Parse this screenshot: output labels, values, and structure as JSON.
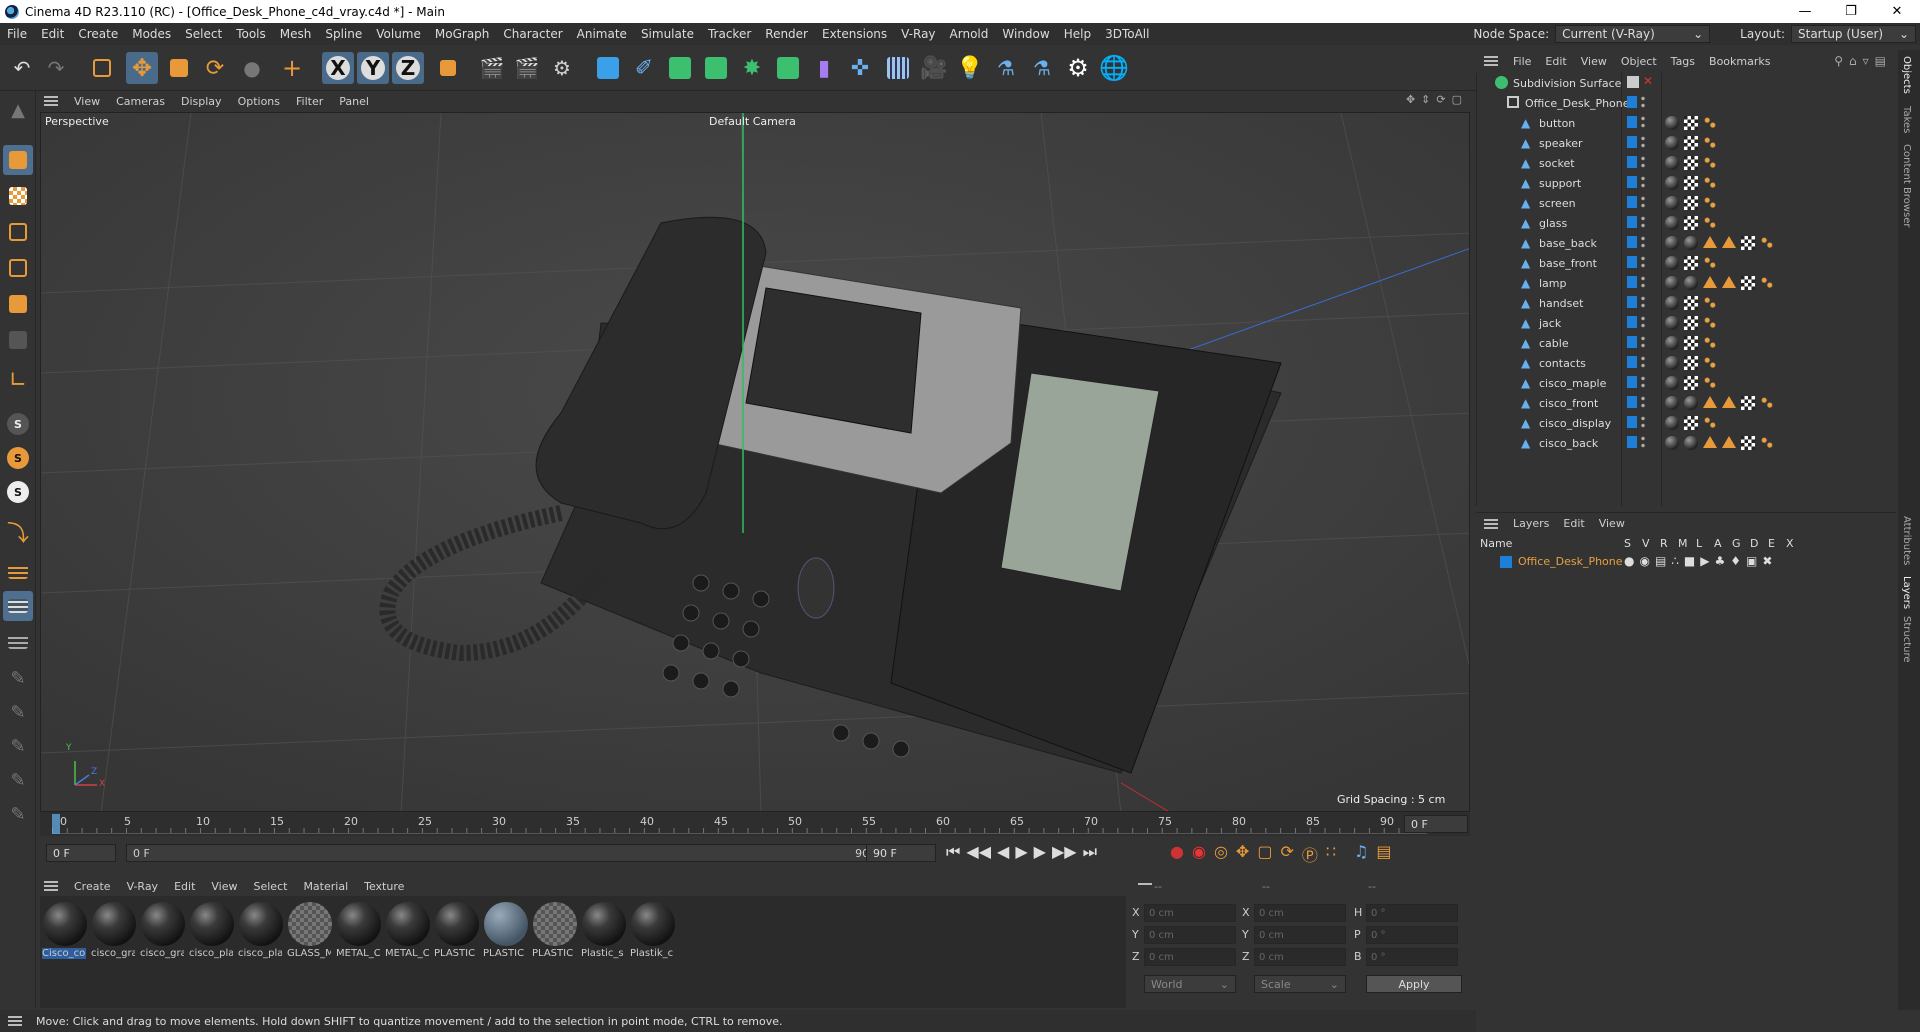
{
  "titlebar": {
    "title": "Cinema 4D R23.110 (RC) - [Office_Desk_Phone_c4d_vray.c4d *] - Main"
  },
  "menubar": {
    "items": [
      "File",
      "Edit",
      "Create",
      "Modes",
      "Select",
      "Tools",
      "Mesh",
      "Spline",
      "Volume",
      "MoGraph",
      "Character",
      "Animate",
      "Simulate",
      "Tracker",
      "Render",
      "Extensions",
      "V-Ray",
      "Arnold",
      "Window",
      "Help",
      "3DToAll"
    ],
    "node_space_label": "Node Space:",
    "node_space_value": "Current (V-Ray)",
    "layout_label": "Layout:",
    "layout_value": "Startup (User)"
  },
  "viewport": {
    "menu": [
      "View",
      "Cameras",
      "Display",
      "Options",
      "Filter",
      "Panel"
    ],
    "label": "Perspective",
    "camera": "Default Camera",
    "grid_spacing": "Grid Spacing : 5 cm",
    "axis_y": "Y",
    "axis_z": "Z",
    "axis_x": "X"
  },
  "timeline": {
    "ticks": [
      "0",
      "5",
      "10",
      "15",
      "20",
      "25",
      "30",
      "35",
      "40",
      "45",
      "50",
      "55",
      "60",
      "65",
      "70",
      "75",
      "80",
      "85",
      "90"
    ],
    "current_frame": "0 F"
  },
  "transport": {
    "start": "0 F",
    "range_start": "0 F",
    "range_end": "90 F",
    "end": "90 F"
  },
  "materials": {
    "menu": [
      "Create",
      "V-Ray",
      "Edit",
      "View",
      "Select",
      "Material",
      "Texture"
    ],
    "items": [
      "Cisco_co",
      "cisco_gra",
      "cisco_gra",
      "cisco_pla",
      "cisco_pla",
      "GLASS_M",
      "METAL_C",
      "METAL_C",
      "PLASTIC",
      "PLASTIC",
      "PLASTIC",
      "Plastic_s",
      "Plastik_c"
    ]
  },
  "coordinates": {
    "header": [
      "--",
      "--",
      "--"
    ],
    "rows": [
      {
        "a": "X",
        "av": "0 cm",
        "b": "X",
        "bv": "0 cm",
        "c": "H",
        "cv": "0 °"
      },
      {
        "a": "Y",
        "av": "0 cm",
        "b": "Y",
        "bv": "0 cm",
        "c": "P",
        "cv": "0 °"
      },
      {
        "a": "Z",
        "av": "0 cm",
        "b": "Z",
        "bv": "0 cm",
        "c": "B",
        "cv": "0 °"
      }
    ],
    "mode1": "World",
    "mode2": "Scale",
    "apply": "Apply"
  },
  "status": "Move: Click and drag to move elements. Hold down SHIFT to quantize movement / add to the selection in point mode, CTRL to remove.",
  "objects": {
    "menu": [
      "File",
      "Edit",
      "View",
      "Object",
      "Tags",
      "Bookmarks"
    ],
    "root": "Subdivision Surface",
    "parent": "Office_Desk_Phone",
    "children": [
      {
        "name": "button",
        "tags": "basic"
      },
      {
        "name": "speaker",
        "tags": "basic"
      },
      {
        "name": "socket",
        "tags": "basic"
      },
      {
        "name": "support",
        "tags": "basic"
      },
      {
        "name": "screen",
        "tags": "basic"
      },
      {
        "name": "glass",
        "tags": "basic"
      },
      {
        "name": "base_back",
        "tags": "extended"
      },
      {
        "name": "base_front",
        "tags": "basic"
      },
      {
        "name": "lamp",
        "tags": "extended"
      },
      {
        "name": "handset",
        "tags": "basic"
      },
      {
        "name": "jack",
        "tags": "basic"
      },
      {
        "name": "cable",
        "tags": "basic"
      },
      {
        "name": "contacts",
        "tags": "basic"
      },
      {
        "name": "cisco_maple",
        "tags": "basic"
      },
      {
        "name": "cisco_front",
        "tags": "extended"
      },
      {
        "name": "cisco_display",
        "tags": "basic"
      },
      {
        "name": "cisco_back",
        "tags": "extended"
      }
    ]
  },
  "layers": {
    "menu": [
      "Layers",
      "Edit",
      "View"
    ],
    "columns": [
      "Name",
      "S",
      "V",
      "R",
      "M",
      "L",
      "A",
      "G",
      "D",
      "E",
      "X"
    ],
    "items": [
      {
        "name": "Office_Desk_Phone",
        "color": "#1e7fd8"
      }
    ]
  },
  "side_tabs": [
    "Objects",
    "Takes",
    "Content Browser",
    "Attributes",
    "Layers",
    "Structure"
  ],
  "colors": {
    "accent": "#1e7fd8",
    "layer_name": "#e8a040",
    "tag_orange": "#e89a3a"
  }
}
